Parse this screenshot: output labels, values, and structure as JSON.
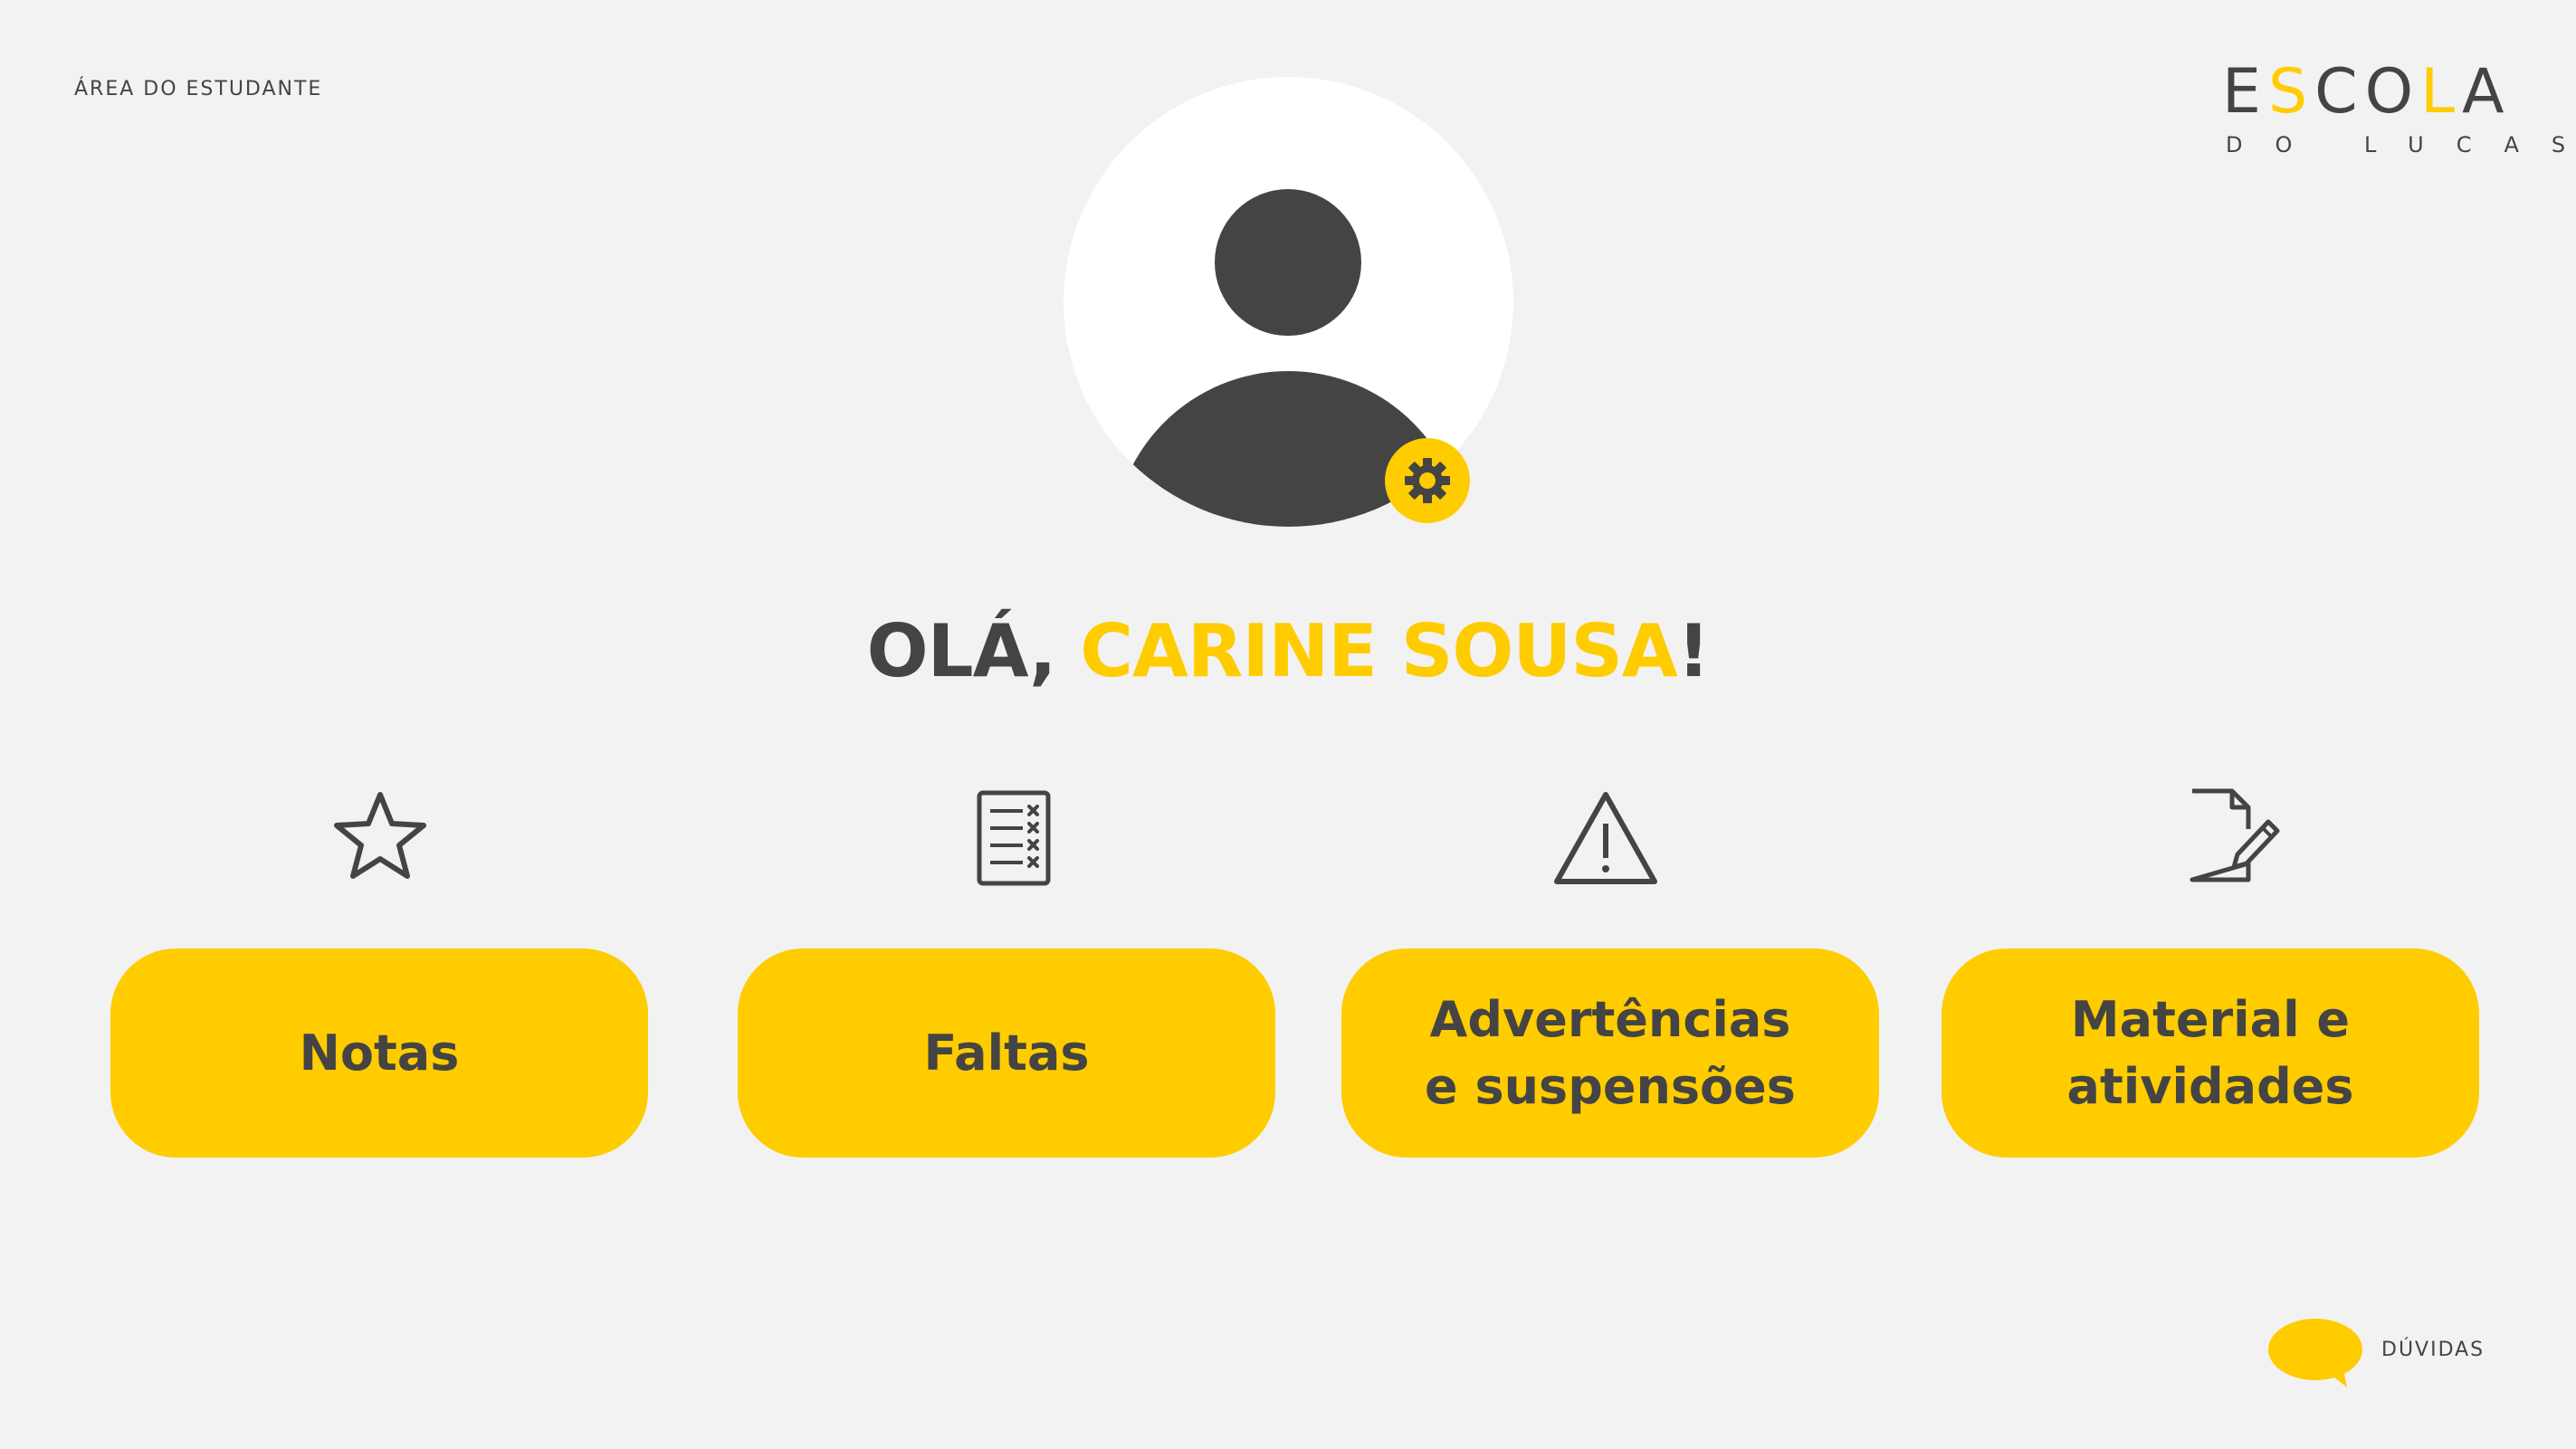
{
  "header": {
    "area_label": "ÁREA DO ESTUDANTE"
  },
  "logo": {
    "letters": [
      {
        "char": "E",
        "color": "#444444"
      },
      {
        "char": "S",
        "color": "#ffcc00"
      },
      {
        "char": "C",
        "color": "#444444"
      },
      {
        "char": "O",
        "color": "#444444"
      },
      {
        "char": "L",
        "color": "#ffcc00"
      },
      {
        "char": "A",
        "color": "#444444"
      }
    ],
    "subtitle": "DO LUCAS"
  },
  "profile": {
    "avatar_icon": "user-avatar-icon",
    "settings_icon": "gear-icon"
  },
  "greeting": {
    "prefix": "OLÁ, ",
    "name": "CARINE SOUSA",
    "suffix": "!"
  },
  "features": [
    {
      "icon": "star-icon",
      "label_lines": [
        "Notas"
      ]
    },
    {
      "icon": "checklist-icon",
      "label_lines": [
        "Faltas"
      ]
    },
    {
      "icon": "warning-icon",
      "label_lines": [
        "Advertências",
        "e suspensões"
      ]
    },
    {
      "icon": "document-edit-icon",
      "label_lines": [
        "Material e",
        "atividades"
      ]
    }
  ],
  "help": {
    "icon": "chat-bubble-icon",
    "label": "DÚVIDAS"
  },
  "colors": {
    "accent": "#ffcc00",
    "text": "#444444",
    "background": "#f2f2f2",
    "avatar_bg": "#ffffff"
  }
}
